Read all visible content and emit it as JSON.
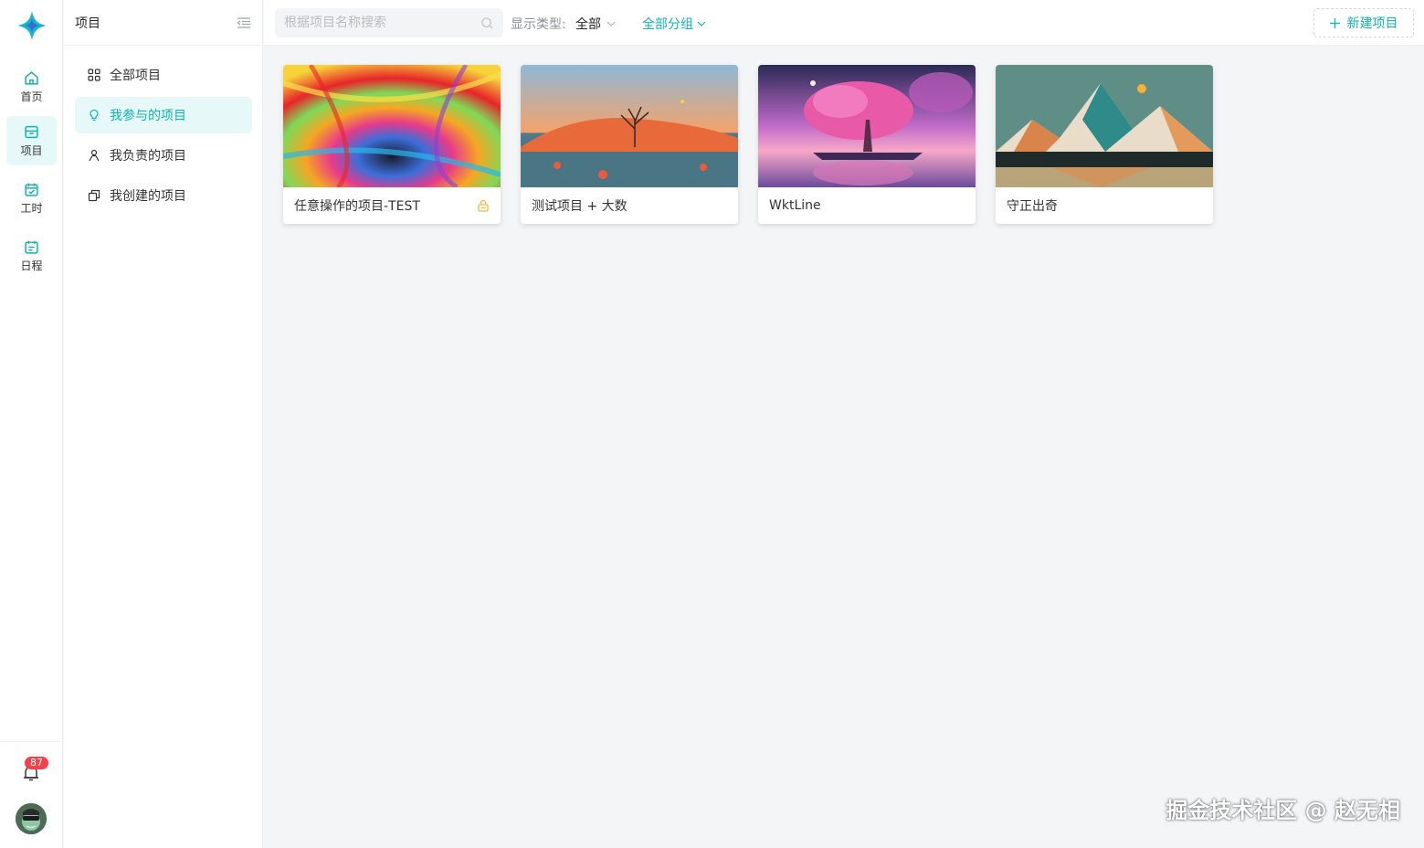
{
  "rail": {
    "items": [
      {
        "label": "首页",
        "icon": "home-icon"
      },
      {
        "label": "项目",
        "icon": "project-icon"
      },
      {
        "label": "工时",
        "icon": "calendar-check-icon"
      },
      {
        "label": "日程",
        "icon": "schedule-icon"
      }
    ],
    "notification_count": "87"
  },
  "sidebar": {
    "title": "项目",
    "items": [
      {
        "label": "全部项目",
        "icon": "grid-icon"
      },
      {
        "label": "我参与的项目",
        "icon": "lightbulb-icon"
      },
      {
        "label": "我负责的项目",
        "icon": "user-icon"
      },
      {
        "label": "我创建的项目",
        "icon": "copy-icon"
      }
    ]
  },
  "topbar": {
    "search_placeholder": "根据项目名称搜索",
    "filter_label": "显示类型:",
    "filter_value": "全部",
    "group_label": "全部分组",
    "new_project_label": "新建项目"
  },
  "projects": [
    {
      "title": "任意操作的项目-TEST",
      "locked": true
    },
    {
      "title": "测试项目 + 大数",
      "locked": false
    },
    {
      "title": "WktLine",
      "locked": false
    },
    {
      "title": "守正出奇",
      "locked": false
    }
  ],
  "footer_watermark": "掘金技术社区 @ 赵无相",
  "colors": {
    "accent": "#11b3b0",
    "badge": "#f5414a",
    "background": "#f3f5f7",
    "lock": "#f5b93b"
  }
}
